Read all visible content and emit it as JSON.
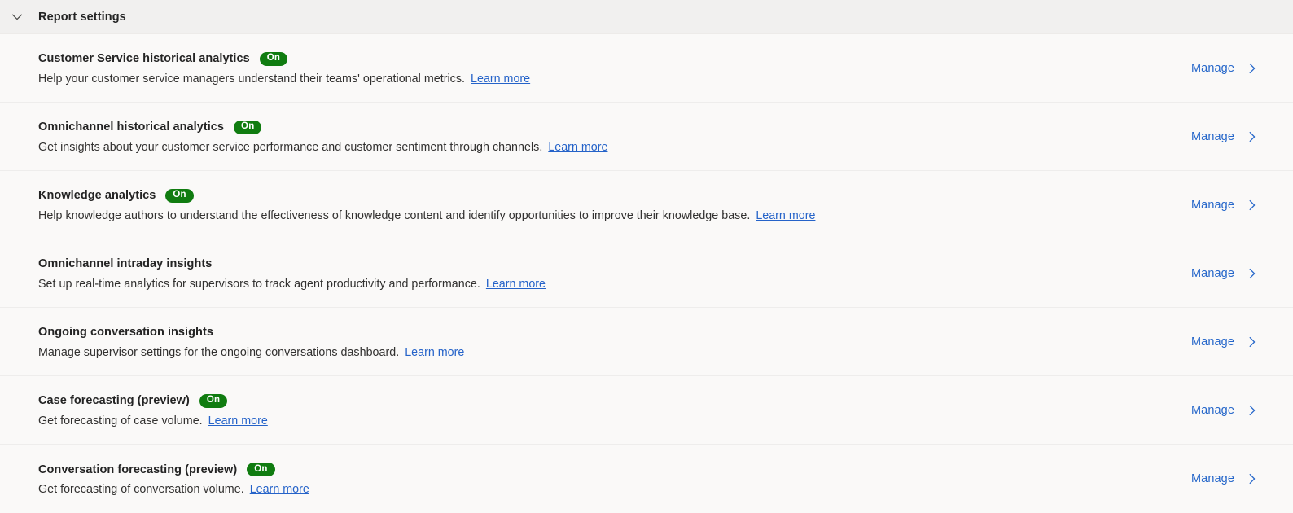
{
  "section": {
    "title": "Report settings",
    "expanded": true,
    "toggle_icon": "chevron-down-icon",
    "header_bg": "#f1f0ef"
  },
  "colors": {
    "page_bg": "#faf9f8",
    "badge_green": "#107c10",
    "link_blue": "#2563c9",
    "manage_blue": "#2667ca",
    "text_primary": "#242424",
    "divider": "#eeedec"
  },
  "common": {
    "manage_label": "Manage",
    "manage_icon": "chevron-right-icon",
    "learn_more_label": "Learn more"
  },
  "rows": [
    {
      "title": "Customer Service historical analytics",
      "badge": "On",
      "description": "Help your customer service managers understand their teams' operational metrics.",
      "learn_more": "Learn more",
      "action": "Manage"
    },
    {
      "title": "Omnichannel historical analytics",
      "badge": "On",
      "description": "Get insights about your customer service performance and customer sentiment through channels.",
      "learn_more": "Learn more",
      "action": "Manage"
    },
    {
      "title": "Knowledge analytics",
      "badge": "On",
      "description": "Help knowledge authors to understand the effectiveness of knowledge content and identify opportunities to improve their knowledge base.",
      "learn_more": "Learn more",
      "action": "Manage"
    },
    {
      "title": "Omnichannel intraday insights",
      "badge": "",
      "description": "Set up real-time analytics for supervisors to track agent productivity and performance.",
      "learn_more": "Learn more",
      "action": "Manage"
    },
    {
      "title": "Ongoing conversation insights",
      "badge": "",
      "description": "Manage supervisor settings for the ongoing conversations dashboard.",
      "learn_more": "Learn more",
      "action": "Manage"
    },
    {
      "title": "Case forecasting (preview)",
      "badge": "On",
      "description": "Get forecasting of case volume.",
      "learn_more": "Learn more",
      "action": "Manage"
    },
    {
      "title": "Conversation forecasting (preview)",
      "badge": "On",
      "description": "Get forecasting of conversation volume.",
      "learn_more": "Learn more",
      "action": "Manage"
    }
  ]
}
